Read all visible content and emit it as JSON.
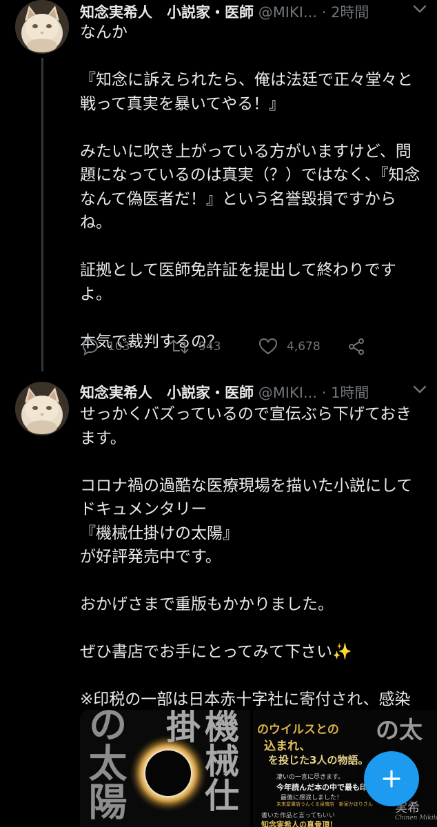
{
  "tweets": [
    {
      "display_name": "知念実希人　小説家・医師",
      "handle": "@MIKI...",
      "dot": "·",
      "time": "2時間",
      "avatar_icon": "cat-avatar-icon",
      "text": "なんか\n\n『知念に訴えられたら、俺は法廷で正々堂々と戦って真実を暴いてやる！』\n\nみたいに吹き上がっている方がいますけど、問題になっているのは真実（？）ではなく、『知念なんて偽医者だ！』という名誉毀損ですからね。\n\n証拠として医師免許証を提出して終わりですよ。\n\n本気で裁判するの？",
      "replies": "103",
      "retweets": "943",
      "likes": "4,678"
    },
    {
      "display_name": "知念実希人　小説家・医師",
      "handle": "@MIKI...",
      "dot": "·",
      "time": "1時間",
      "avatar_icon": "cat-avatar-icon",
      "text": "せっかくバズっているので宣伝ぶら下げておきます。\n\nコロナ禍の過酷な医療現場を描いた小説にしてドキュメンタリー\n『機械仕掛けの太陽』\nが好評発売中です。\n\nおかげさまで重版もかかりました。\n\nぜひ書店でお手にとってみて下さい✨\n\n※印税の一部は日本赤十字社に寄付され、感染対策等に使われます"
    }
  ],
  "media": {
    "left_cover": {
      "vertical_left": "の太陽",
      "vertical_right": "機械仕掛"
    },
    "right_cover": {
      "line1": "のウイルスとの",
      "line2": "込まれ、",
      "line3": "を投じた3人の物語。",
      "line4": "凄いの一言に尽きます。",
      "line5": "今年読んだ本の中で最も印象的で",
      "line6": "最後に感涙しました！",
      "line7": "未来屋書店うんくる泉南店　新家かほりさん",
      "line8": "書いた作品と言ってもいい",
      "line9": "知念実希人の真骨頂！",
      "side_text": "の太",
      "author_signature": "Chinen Mikito",
      "author_fragment": "実希"
    }
  },
  "colors": {
    "accent": "#1d9bf0",
    "background": "#000000",
    "muted": "#71767b"
  },
  "fab": {
    "icon": "plus-icon"
  }
}
